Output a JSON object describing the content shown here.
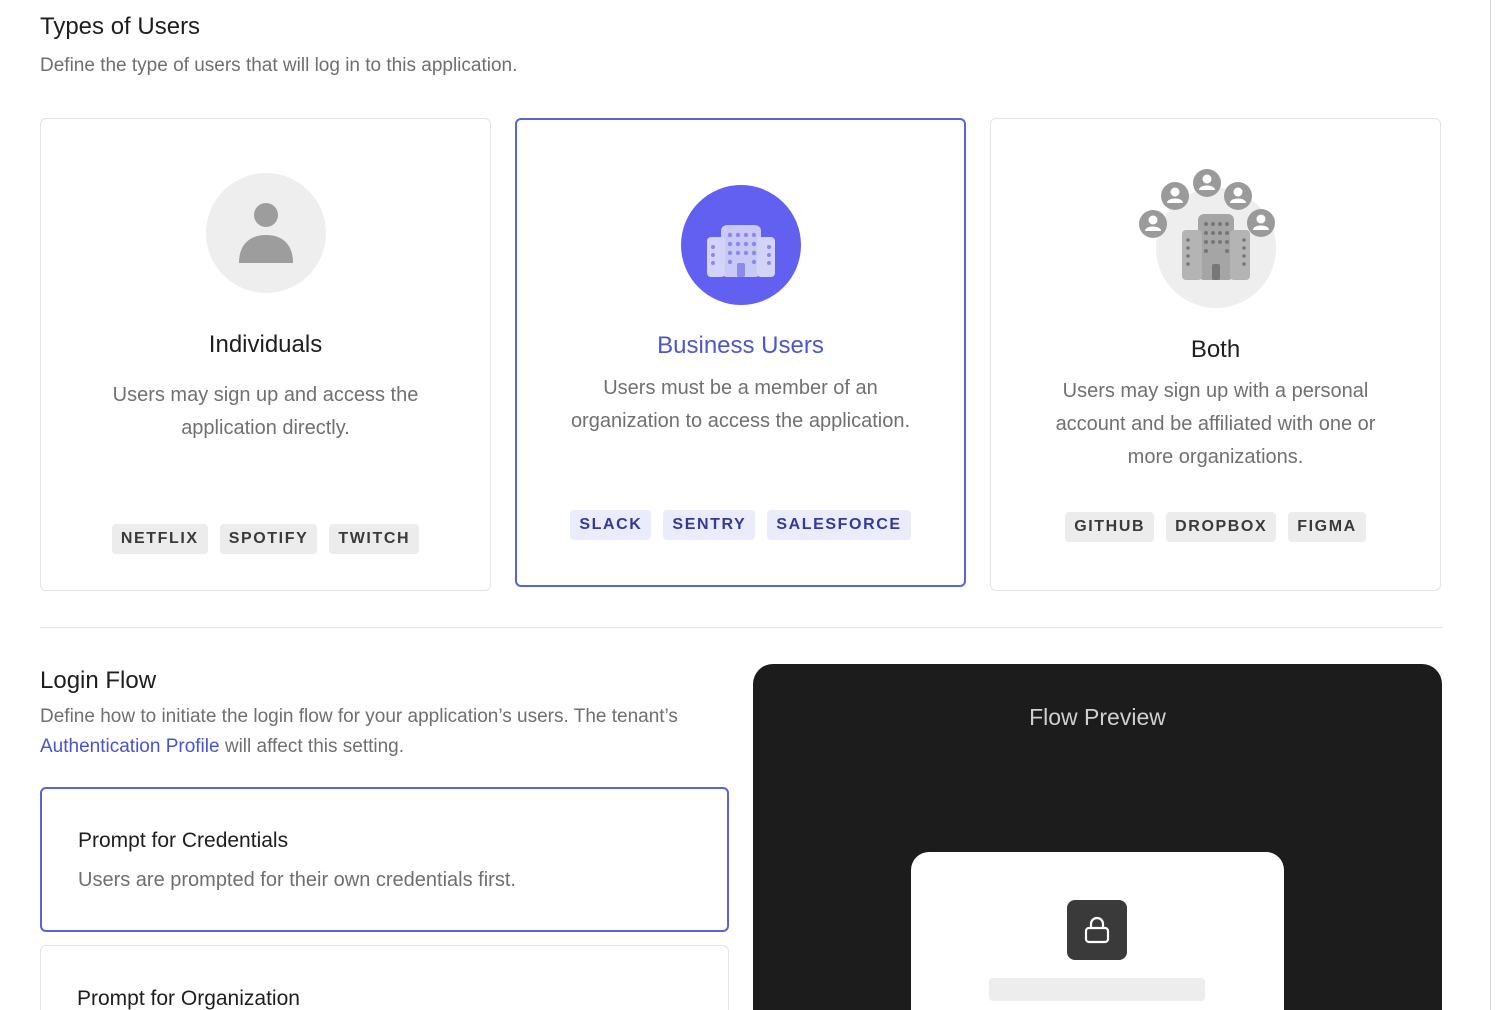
{
  "types": {
    "title": "Types of Users",
    "description": "Define the type of users that will log in to this application."
  },
  "cards": [
    {
      "title": "Individuals",
      "description": "Users may sign up and access the application directly.",
      "icon": "person-icon",
      "badges": [
        "NETFLIX",
        "SPOTIFY",
        "TWITCH"
      ],
      "selected": false
    },
    {
      "title": "Business Users",
      "description": "Users must be a member of an organization to access the application.",
      "icon": "building-icon",
      "badges": [
        "SLACK",
        "SENTRY",
        "SALESFORCE"
      ],
      "selected": true
    },
    {
      "title": "Both",
      "description": "Users may sign up with a personal account and be affiliated with one or more organizations.",
      "icon": "building-with-people-icon",
      "badges": [
        "GITHUB",
        "DROPBOX",
        "FIGMA"
      ],
      "selected": false
    }
  ],
  "login_flow": {
    "title": "Login Flow",
    "description_part1": "Define how to initiate the login flow for your application’s users. The tenant’s",
    "link_text": "Authentication Profile",
    "description_part2": "will affect this setting.",
    "options": [
      {
        "title": "Prompt for Credentials",
        "description": "Users are prompted for their own credentials first.",
        "selected": true
      },
      {
        "title": "Prompt for Organization",
        "description": "",
        "selected": false
      }
    ]
  },
  "preview": {
    "title": "Flow Preview",
    "icon": "lock-icon"
  },
  "colors": {
    "accent": "#5a62d6",
    "accent_text": "#4d57c9",
    "preview_bg": "#1c1c1c"
  }
}
